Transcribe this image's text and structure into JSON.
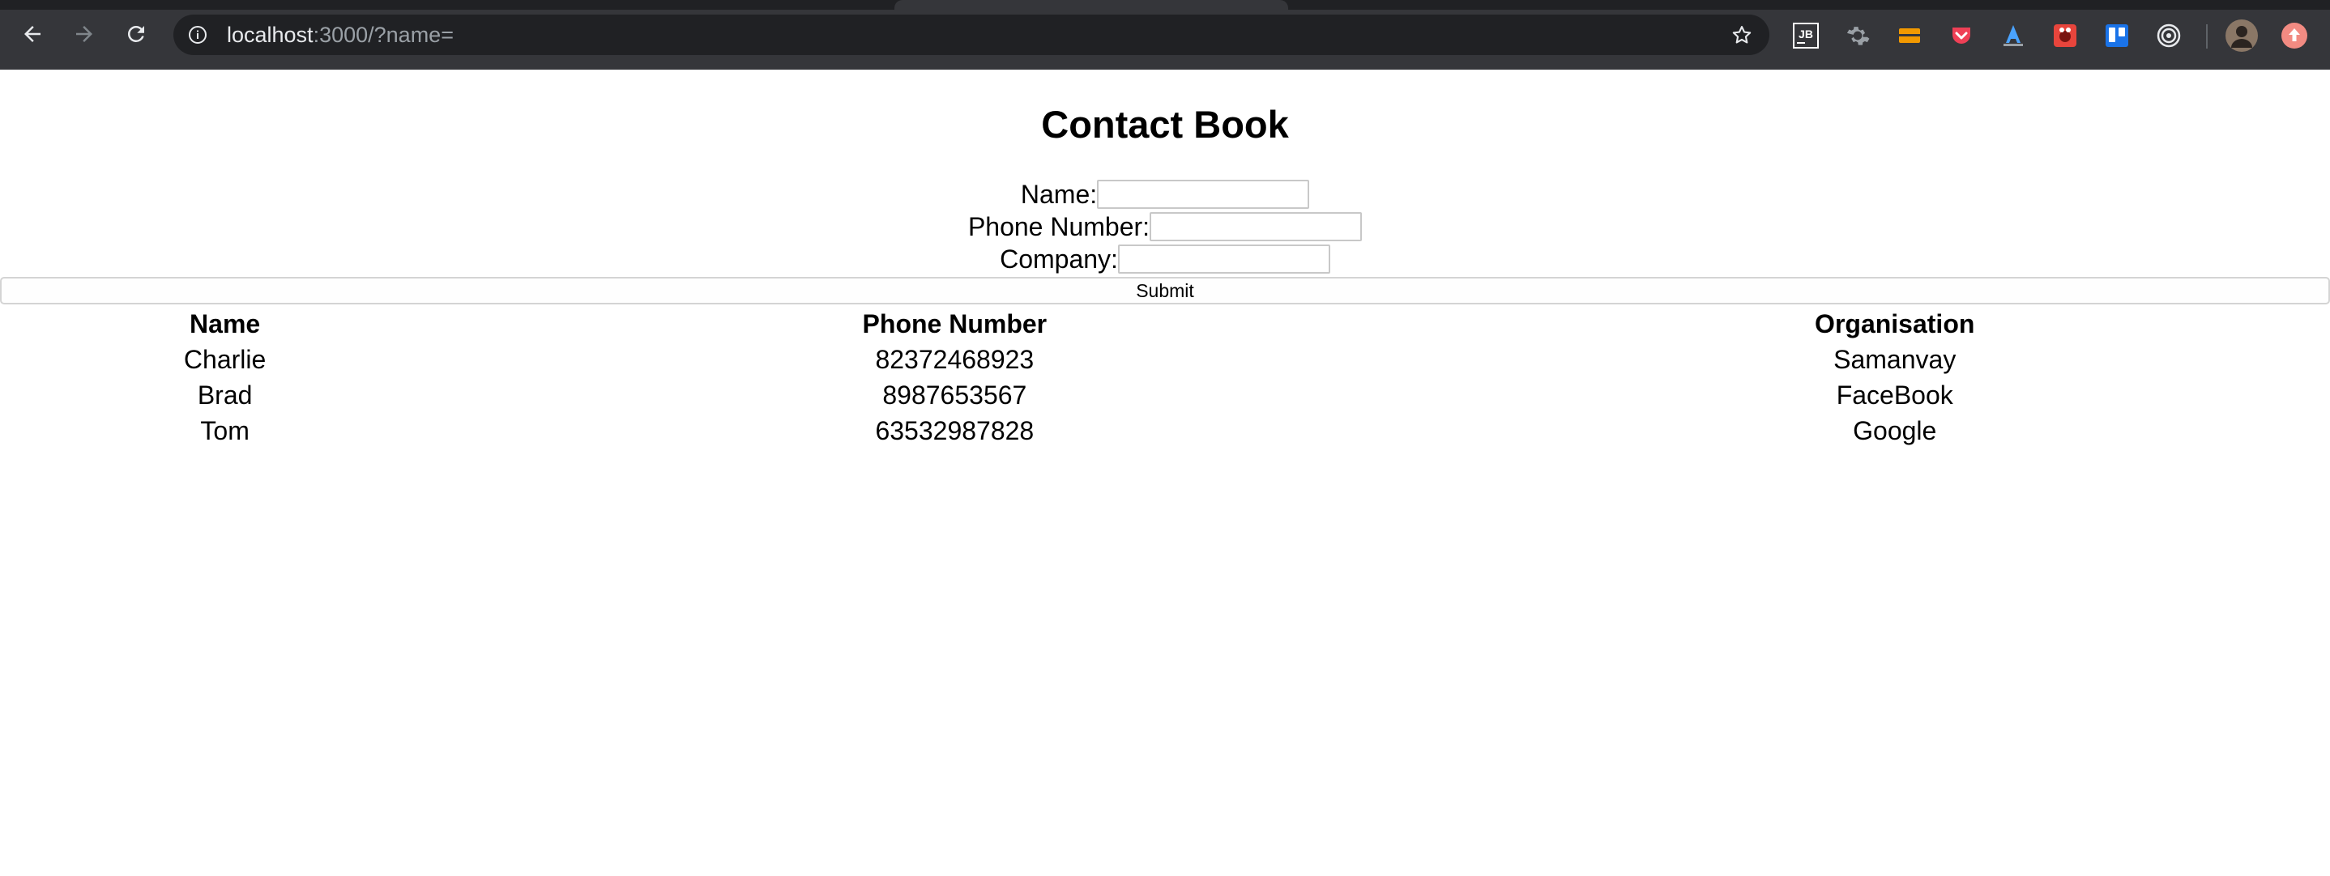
{
  "browser": {
    "url_host": "localhost",
    "url_rest": ":3000/?name=",
    "extensions": [
      {
        "icon": "jetbrains-icon",
        "label": "JB",
        "color": "#ffffff"
      },
      {
        "icon": "gear-extension-icon",
        "color": "#9aa0a6"
      },
      {
        "icon": "orange-extension-icon",
        "color": "#f29900"
      },
      {
        "icon": "pocket-icon",
        "color": "#ef4056"
      },
      {
        "icon": "blue-a-extension-icon",
        "color": "#4aa3ff"
      },
      {
        "icon": "red-bug-extension-icon",
        "color": "#e8453c"
      },
      {
        "icon": "trello-icon",
        "color": "#1a73e8"
      },
      {
        "icon": "target-extension-icon",
        "color": "#e8eaed"
      },
      {
        "icon": "profile-avatar",
        "color": "#8a7766"
      },
      {
        "icon": "update-icon",
        "color": "#f28b82"
      }
    ]
  },
  "page": {
    "title": "Contact Book",
    "form": {
      "name_label": "Name:",
      "name_value": "",
      "phone_label": "Phone Number:",
      "phone_value": "",
      "company_label": "Company:",
      "company_value": "",
      "submit_label": "Submit"
    },
    "table": {
      "headers": [
        "Name",
        "Phone Number",
        "Organisation"
      ],
      "rows": [
        [
          "Charlie",
          "82372468923",
          "Samanvay"
        ],
        [
          "Brad",
          "8987653567",
          "FaceBook"
        ],
        [
          "Tom",
          "63532987828",
          "Google"
        ]
      ]
    }
  }
}
